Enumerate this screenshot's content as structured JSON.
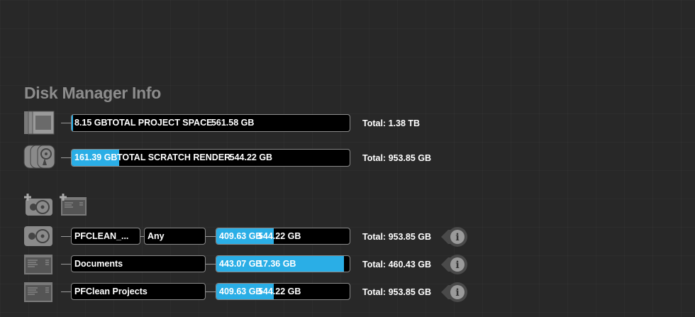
{
  "title": "Disk Manager Info",
  "summary": [
    {
      "used": "8.15 GB",
      "label": "TOTAL PROJECT SPACE",
      "free": "561.58 GB",
      "total": "Total: 1.38 TB",
      "fill": 0.006,
      "icon": "project-stack-icon"
    },
    {
      "used": "161.39 GB",
      "label": "TOTAL SCRATCH RENDER",
      "free": "544.22 GB",
      "total": "Total: 953.85 GB",
      "fill": 0.17,
      "icon": "disk-stack-icon"
    }
  ],
  "add_buttons": [
    {
      "icon": "add-disk-icon"
    },
    {
      "icon": "add-folder-icon"
    }
  ],
  "volumes": [
    {
      "name": "PFCLEAN_...",
      "filter": "Any",
      "used": "409.63 GB",
      "free": "544.22 GB",
      "total": "Total: 953.85 GB",
      "fill": 0.43,
      "icon": "disk-icon"
    },
    {
      "name": "Documents",
      "used": "443.07 GB",
      "free": "17.36 GB",
      "total": "Total: 460.43 GB",
      "fill": 0.96,
      "icon": "folder-window-icon"
    },
    {
      "name": "PFClean Projects",
      "used": "409.63 GB",
      "free": "544.22 GB",
      "total": "Total: 953.85 GB",
      "fill": 0.43,
      "icon": "folder-window-icon"
    }
  ],
  "colors": {
    "accent": "#2aaee6",
    "background": "#282828"
  }
}
